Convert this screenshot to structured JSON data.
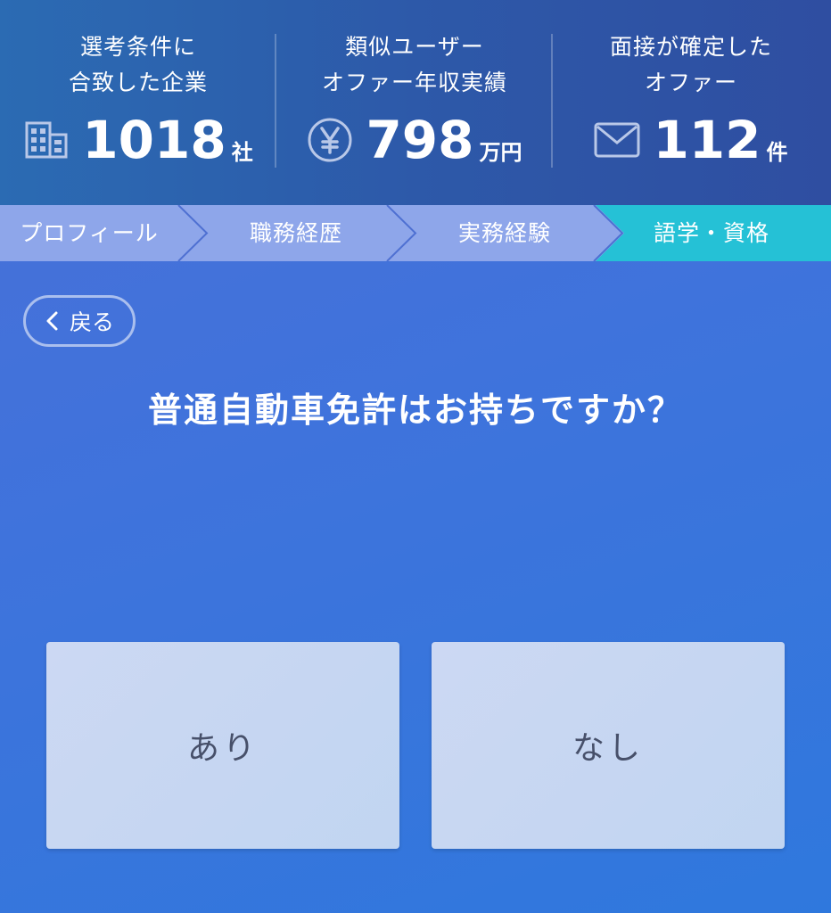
{
  "stats": [
    {
      "label_line1": "選考条件に",
      "label_line2": "合致した企業",
      "icon": "building-icon",
      "value": "1018",
      "unit": "社"
    },
    {
      "label_line1": "類似ユーザー",
      "label_line2": "オファー年収実績",
      "icon": "yen-icon",
      "value": "798",
      "unit": "万円"
    },
    {
      "label_line1": "面接が確定した",
      "label_line2": "オファー",
      "icon": "mail-icon",
      "value": "112",
      "unit": "件"
    }
  ],
  "steps": [
    {
      "label": "プロフィール",
      "active": false
    },
    {
      "label": "職務経歴",
      "active": false
    },
    {
      "label": "実務経験",
      "active": false
    },
    {
      "label": "語学・資格",
      "active": true
    }
  ],
  "back_label": "戻る",
  "question": "普通自動車免許はお持ちですか？",
  "answers": [
    "あり",
    "なし"
  ],
  "colors": {
    "header_bg": "#2d5aa9",
    "step_bg": "#8ea6ea",
    "step_active": "#25c1d6",
    "main_bg": "#3f73dc",
    "answer_bg": "#c6d6f2",
    "answer_text": "#47506a"
  }
}
